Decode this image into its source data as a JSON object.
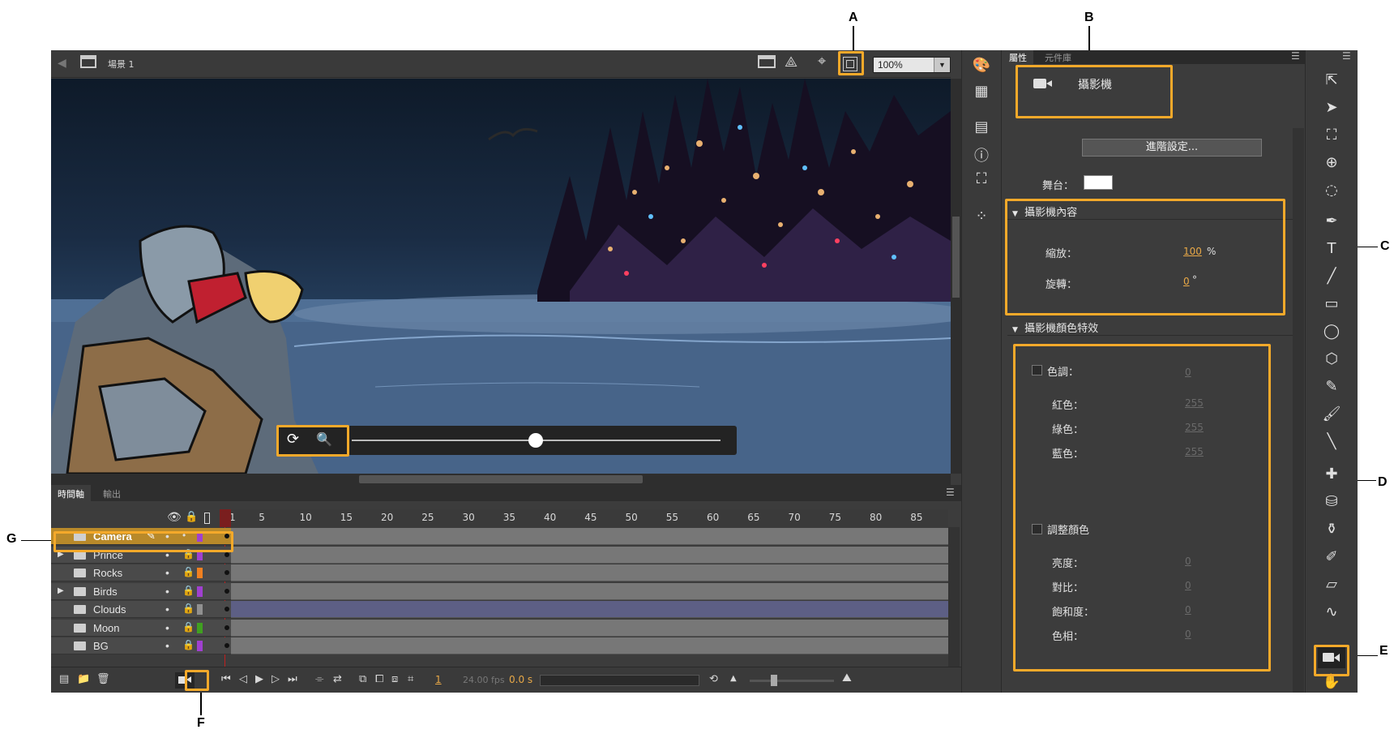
{
  "callouts": {
    "a": "A",
    "b": "B",
    "c": "C",
    "d": "D",
    "e": "E",
    "f": "F",
    "g": "G"
  },
  "stage_header": {
    "scene_label": "場景 1",
    "zoom_value": "100%"
  },
  "properties": {
    "tabs": [
      "屬性",
      "元件庫"
    ],
    "object_name": "攝影機",
    "advanced_button": "進階設定...",
    "stage_label": "舞台：",
    "stage_color": "#ffffff",
    "section_camera": "攝影機內容",
    "zoom_label": "縮放：",
    "zoom_value": "100",
    "zoom_unit": "%",
    "rotate_label": "旋轉：",
    "rotate_value": "0",
    "rotate_unit": "°",
    "section_color": "攝影機顏色特效",
    "tint_label": "色調：",
    "tint_value": "0",
    "red_label": "紅色：",
    "red_value": "255",
    "green_label": "綠色：",
    "green_value": "255",
    "blue_label": "藍色：",
    "blue_value": "255",
    "adjust_label": "調整顏色",
    "brightness_label": "亮度：",
    "brightness_value": "0",
    "contrast_label": "對比：",
    "contrast_value": "0",
    "saturation_label": "飽和度：",
    "saturation_value": "0",
    "hue_label": "色相：",
    "hue_value": "0"
  },
  "timeline": {
    "tabs": [
      "時間軸",
      "輸出"
    ],
    "ruler": [
      "1",
      "5",
      "10",
      "15",
      "20",
      "25",
      "30",
      "35",
      "40",
      "45",
      "50",
      "55",
      "60",
      "65",
      "70",
      "75",
      "80",
      "85"
    ],
    "layers": [
      {
        "name": "Camera",
        "color": "#a040d0"
      },
      {
        "name": "Prince",
        "color": "#a040d0"
      },
      {
        "name": "Rocks",
        "color": "#f08020"
      },
      {
        "name": "Birds",
        "color": "#a040d0"
      },
      {
        "name": "Clouds",
        "color": "#909090"
      },
      {
        "name": "Moon",
        "color": "#40a020"
      },
      {
        "name": "BG",
        "color": "#a040d0"
      }
    ],
    "current_frame": "1",
    "fps": "24.00 fps",
    "time": "0.0 s"
  }
}
